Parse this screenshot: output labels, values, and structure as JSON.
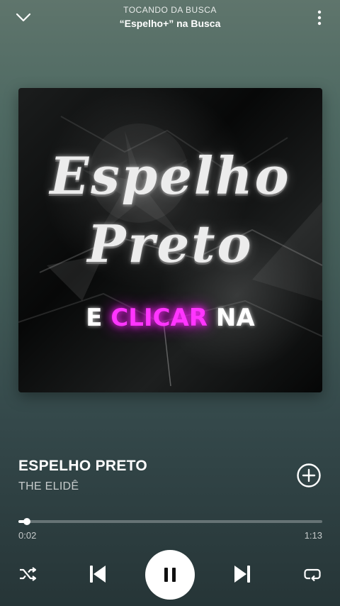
{
  "header": {
    "context_label": "TOCANDO DA BUSCA",
    "context_title": "“Espelho+” na Busca",
    "collapse_icon": "chevron-down-icon",
    "more_icon": "more-vertical-icon"
  },
  "cover": {
    "title_line1": "Espelho",
    "title_line2": "Preto",
    "caption_pre": "E",
    "caption_highlight": "CLICAR",
    "caption_post": "NA",
    "caption_highlight_color": "#ff35ff"
  },
  "track": {
    "title": "ESPELHO PRETO",
    "artist": "THE ELIDÊ",
    "add_icon": "add-circle-icon"
  },
  "playback": {
    "elapsed": "0:02",
    "total": "1:13",
    "progress_fraction": 0.027,
    "is_playing": true
  },
  "controls": {
    "shuffle_icon": "shuffle-icon",
    "previous_icon": "skip-previous-icon",
    "play_pause_icon": "pause-icon",
    "next_icon": "skip-next-icon",
    "repeat_icon": "repeat-icon"
  },
  "colors": {
    "accent": "#ffffff",
    "background_top": "#5f756c",
    "background_bottom": "#263537"
  }
}
